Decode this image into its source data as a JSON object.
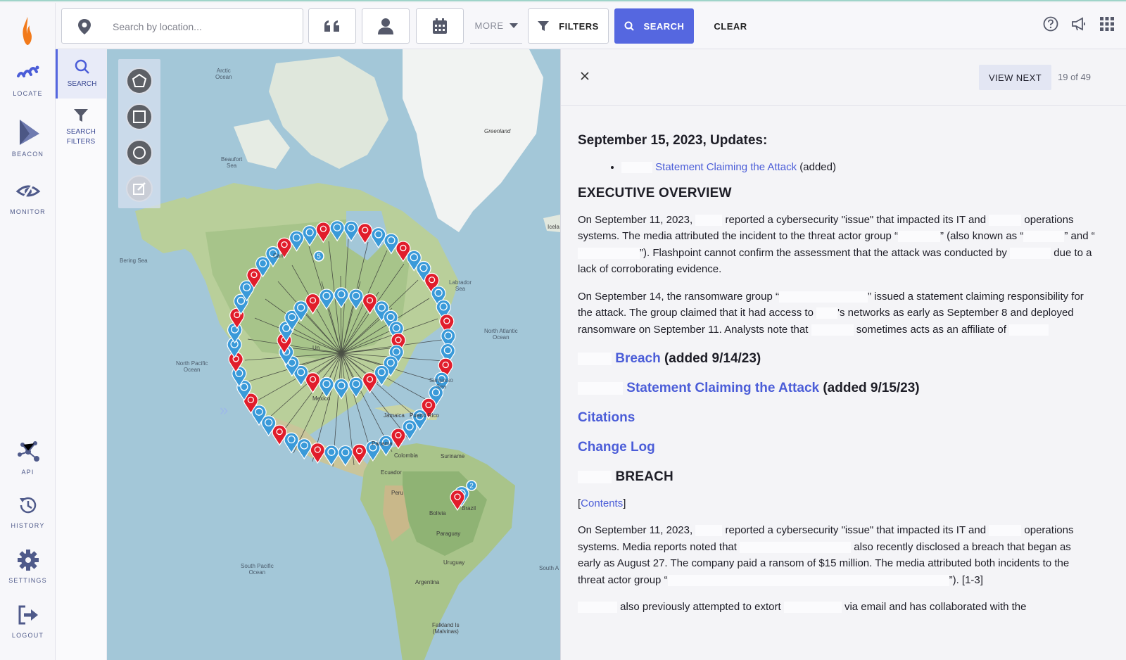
{
  "rail": {
    "items": [
      {
        "label": "LOCATE",
        "icon": "locate-icon"
      },
      {
        "label": "BEACON",
        "icon": "beacon-icon"
      },
      {
        "label": "MONITOR",
        "icon": "eye-icon"
      },
      {
        "label": "API",
        "icon": "api-icon"
      },
      {
        "label": "HISTORY",
        "icon": "history-icon"
      },
      {
        "label": "SETTINGS",
        "icon": "gear-icon"
      },
      {
        "label": "LOGOUT",
        "icon": "logout-icon"
      }
    ],
    "accent": "#5567e0"
  },
  "subrail": {
    "search_label": "SEARCH",
    "filters_label_1": "SEARCH",
    "filters_label_2": "FILTERS"
  },
  "topbar": {
    "search_placeholder": "Search by location...",
    "more_label": "MORE",
    "filters_label": "FILTERS",
    "search_label": "SEARCH",
    "clear_label": "CLEAR"
  },
  "map": {
    "labels": {
      "arctic": "Arctic\nOcean",
      "greenland": "Greenland",
      "beaufort": "Beaufort\nSea",
      "bering": "Bering Sea",
      "canada": "Can",
      "labrador": "Labrador\nSea",
      "north_atlantic": "North Atlantic\nOcean",
      "north_pacific": "North Pacific\nOcean",
      "sargasso": "Sargasso\nSea",
      "mexico": "Mexico",
      "jamaica": "Jamaica",
      "puerto_rico": "Puerto Rico",
      "panama": "Panama",
      "colombia": "Colombia",
      "suriname": "Suriname",
      "ecuador": "Ecuador",
      "peru": "Peru",
      "brazil": "Brazil",
      "bolivia": "Bolivia",
      "paraguay": "Paraguay",
      "uruguay": "Uruguay",
      "argentina": "Argentina",
      "south_pacific": "South Pacific\nOcean",
      "south_atlantic": "South A",
      "falkland": "Falkland Is\n(Malvinas)",
      "iceland": "Icela",
      "un": "Un"
    },
    "cluster_counts": [
      "5",
      "2"
    ]
  },
  "panel": {
    "view_next": "VIEW NEXT",
    "pager": "19 of 49",
    "update_heading": "September 15, 2023, Updates:",
    "update_item_link": "Statement Claiming the Attack",
    "update_item_suffix": "(added)",
    "exec_heading": "EXECUTIVE OVERVIEW",
    "p1_a": "On September 11, 2023,",
    "p1_b": "reported a cybersecurity \"issue\" that impacted its IT and",
    "p1_c": "operations systems. The media attributed the incident to the threat actor group “",
    "p1_d": "” (also known as “",
    "p1_e": "” and “",
    "p1_f": "”). Flashpoint cannot confirm the assessment that the attack was conducted by",
    "p1_g": "due to a lack of corroborating evidence.",
    "p2_a": "On September 14, the ransomware group “",
    "p2_b": "” issued a statement claiming responsibility for the attack. The group claimed that it had access to",
    "p2_c": "'s networks as early as September 8 and deployed ransomware on September 11. Analysts note that",
    "p2_d": "sometimes acts as an affiliate of",
    "toc_breach_link": "Breach",
    "toc_breach_suffix": "(added 9/14/23)",
    "toc_statement_link": "Statement Claiming the Attack",
    "toc_statement_suffix": "(added 9/15/23)",
    "toc_citations": "Citations",
    "toc_changelog": "Change Log",
    "breach_heading": "BREACH",
    "contents_open": "[",
    "contents_link": "Contents",
    "contents_close": "]",
    "p3_a": "On September 11, 2023,",
    "p3_b": "reported a cybersecurity \"issue\" that impacted its IT and",
    "p3_c": "operations systems. Media reports noted that",
    "p3_d": "also recently disclosed a breach that began as early as August 27. The company paid a ransom of $15 million. The media attributed both incidents to the threat actor group “",
    "p3_e": "”). [1-3]",
    "p4_a": "also previously attempted to extort",
    "p4_b": "via email and has collaborated with the"
  }
}
